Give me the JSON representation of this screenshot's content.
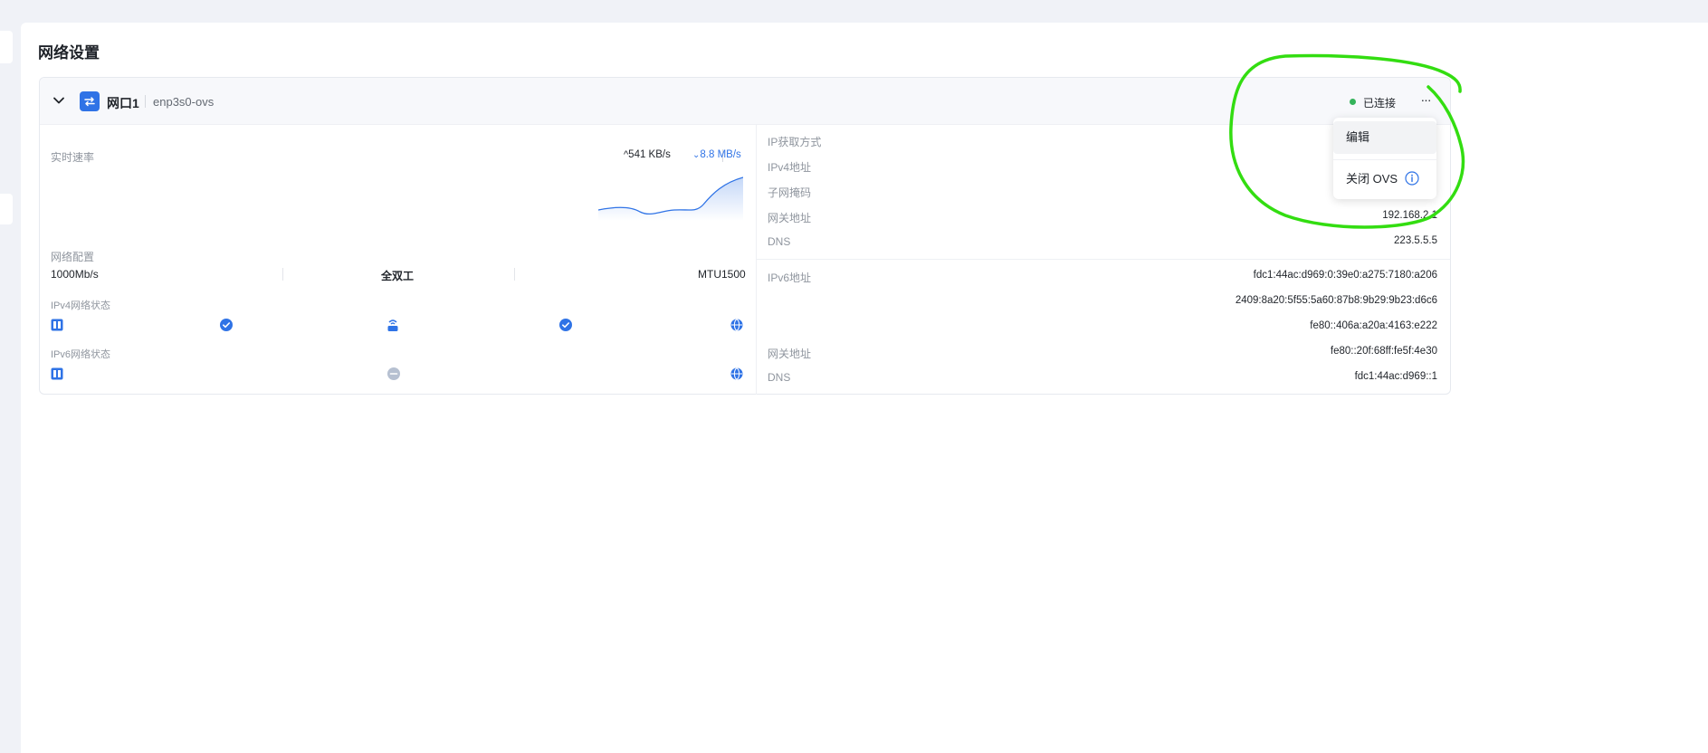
{
  "page": {
    "title": "网络设置"
  },
  "port": {
    "name": "网口1",
    "interface": "enp3s0-ovs",
    "status": "已连接",
    "more_label": "···"
  },
  "menu": {
    "items": [
      {
        "label": "编辑"
      },
      {
        "label": "关闭 OVS"
      }
    ]
  },
  "speed": {
    "label": "实时速率",
    "upload": "541 KB/s",
    "download": "8.8 MB/s"
  },
  "config": {
    "label": "网络配置",
    "bandwidth": "1000Mb/s",
    "duplex": "全双工",
    "mtu": "MTU1500"
  },
  "ipv4_status": {
    "label": "IPv4网络状态"
  },
  "ipv6_status": {
    "label": "IPv6网络状态"
  },
  "ipv4": {
    "rows": [
      {
        "label": "IP获取方式",
        "value": ""
      },
      {
        "label": "IPv4地址",
        "value": ""
      },
      {
        "label": "子网掩码",
        "value": ""
      },
      {
        "label": "网关地址",
        "value": "192.168.2.1"
      },
      {
        "label": "DNS",
        "value": "223.5.5.5"
      }
    ]
  },
  "ipv6": {
    "address_label": "IPv6地址",
    "addresses": [
      "fdc1:44ac:d969:0:39e0:a275:7180:a206",
      "2409:8a20:5f55:5a60:87b8:9b29:9b23:d6c6",
      "fe80::406a:a20a:4163:e222"
    ],
    "gateway_label": "网关地址",
    "gateway": "fe80::20f:68ff:fe5f:4e30",
    "dns_label": "DNS",
    "dns": "fdc1:44ac:d969::1"
  },
  "colors": {
    "accent": "#2f73e6",
    "status_green": "#34b35a",
    "annotation": "#33dd11"
  }
}
